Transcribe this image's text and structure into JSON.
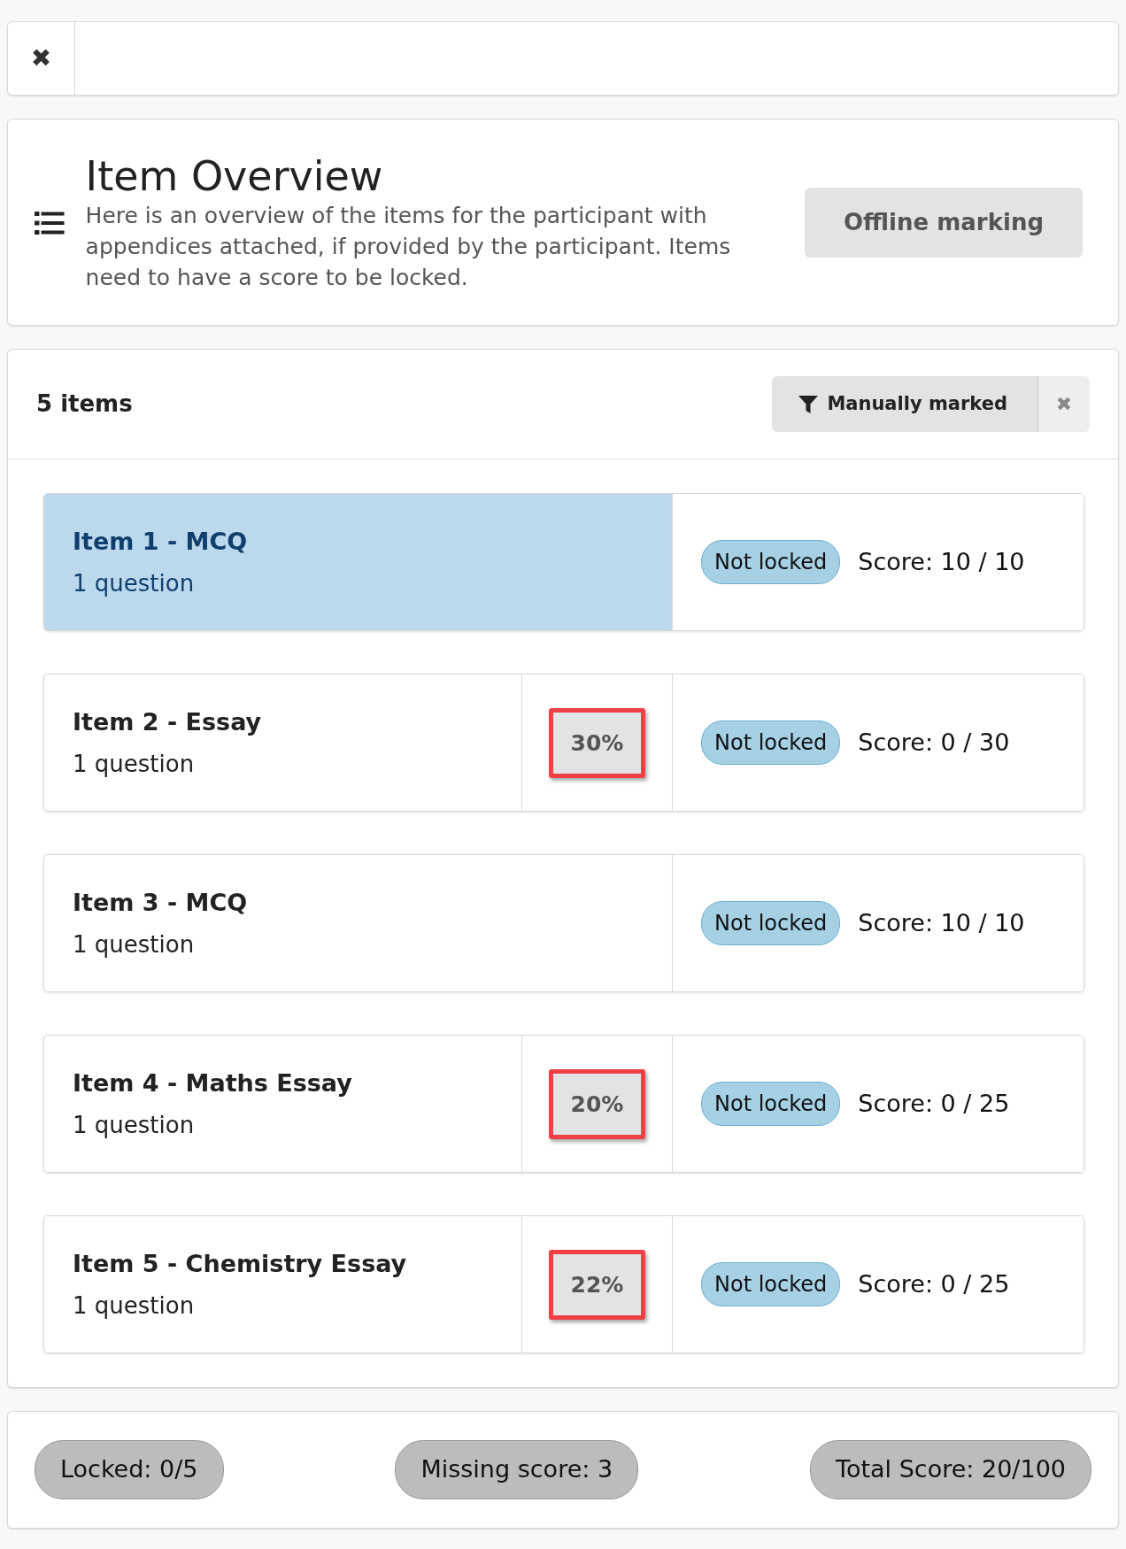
{
  "top_bar": {
    "close": "✖"
  },
  "header": {
    "title": "Item Overview",
    "description": "Here is an overview of the items for the participant with appendices attached, if provided by the participant. Items need to have a score to be locked.",
    "button": "Offline marking"
  },
  "list": {
    "count": "5 items",
    "filter": {
      "label": "Manually marked",
      "clear": "✖"
    },
    "items": [
      {
        "title": "Item 1 - MCQ",
        "subtitle": "1 question",
        "selected": true,
        "status": "Not locked",
        "score": "Score: 10 / 10"
      },
      {
        "title": "Item 2 - Essay",
        "subtitle": "1 question",
        "selected": false,
        "percentage": "30%",
        "highlighted": true,
        "status": "Not locked",
        "score": "Score: 0 / 30"
      },
      {
        "title": "Item 3 - MCQ",
        "subtitle": "1 question",
        "selected": false,
        "status": "Not locked",
        "score": "Score: 10 / 10"
      },
      {
        "title": "Item 4 - Maths Essay",
        "subtitle": "1 question",
        "selected": false,
        "percentage": "20%",
        "highlighted": true,
        "status": "Not locked",
        "score": "Score: 0 / 25"
      },
      {
        "title": "Item 5 - Chemistry Essay",
        "subtitle": "1 question",
        "selected": false,
        "percentage": "22%",
        "highlighted": true,
        "status": "Not locked",
        "score": "Score: 0 / 25"
      }
    ]
  },
  "footer": {
    "locked": "Locked: 0/5",
    "missing": "Missing score: 3",
    "total": "Total Score: 20/100"
  }
}
